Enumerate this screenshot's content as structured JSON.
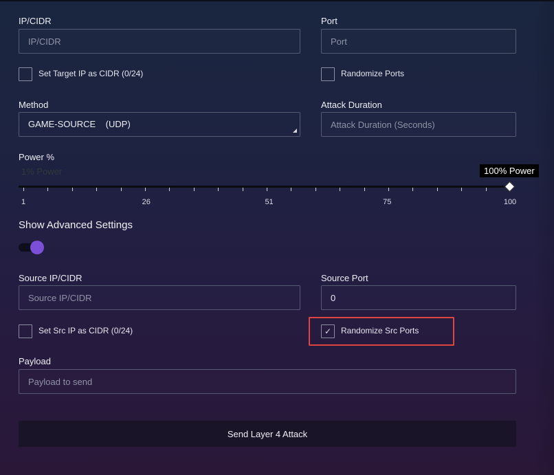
{
  "target": {
    "ip_label": "IP/CIDR",
    "ip_placeholder": "IP/CIDR",
    "port_label": "Port",
    "port_placeholder": "Port",
    "cidr_checkbox_label": "Set Target IP as CIDR (0/24)",
    "cidr_checked": false,
    "randomize_ports_label": "Randomize Ports",
    "randomize_ports_checked": false
  },
  "method": {
    "label": "Method",
    "selected": "GAME-SOURCE    (UDP)"
  },
  "duration": {
    "label": "Attack Duration",
    "placeholder": "Attack Duration (Seconds)"
  },
  "power": {
    "label": "Power %",
    "ghost_text": "1% Power",
    "tooltip": "100% Power",
    "value": 100,
    "min": 1,
    "max": 100,
    "tick_labels": [
      "1",
      "26",
      "51",
      "75",
      "100"
    ]
  },
  "advanced": {
    "title": "Show Advanced Settings",
    "toggle_on": true,
    "source_ip_label": "Source IP/CIDR",
    "source_ip_placeholder": "Source IP/CIDR",
    "source_port_label": "Source Port",
    "source_port_value": "0",
    "src_cidr_label": "Set Src IP as CIDR (0/24)",
    "src_cidr_checked": false,
    "randomize_src_label": "Randomize Src Ports",
    "randomize_src_checked": true,
    "checkmark": "✓"
  },
  "payload": {
    "label": "Payload",
    "placeholder": "Payload to send"
  },
  "submit": {
    "label": "Send Layer 4 Attack"
  },
  "colors": {
    "accent": "#7b4fd6",
    "highlight": "#e0443f"
  }
}
